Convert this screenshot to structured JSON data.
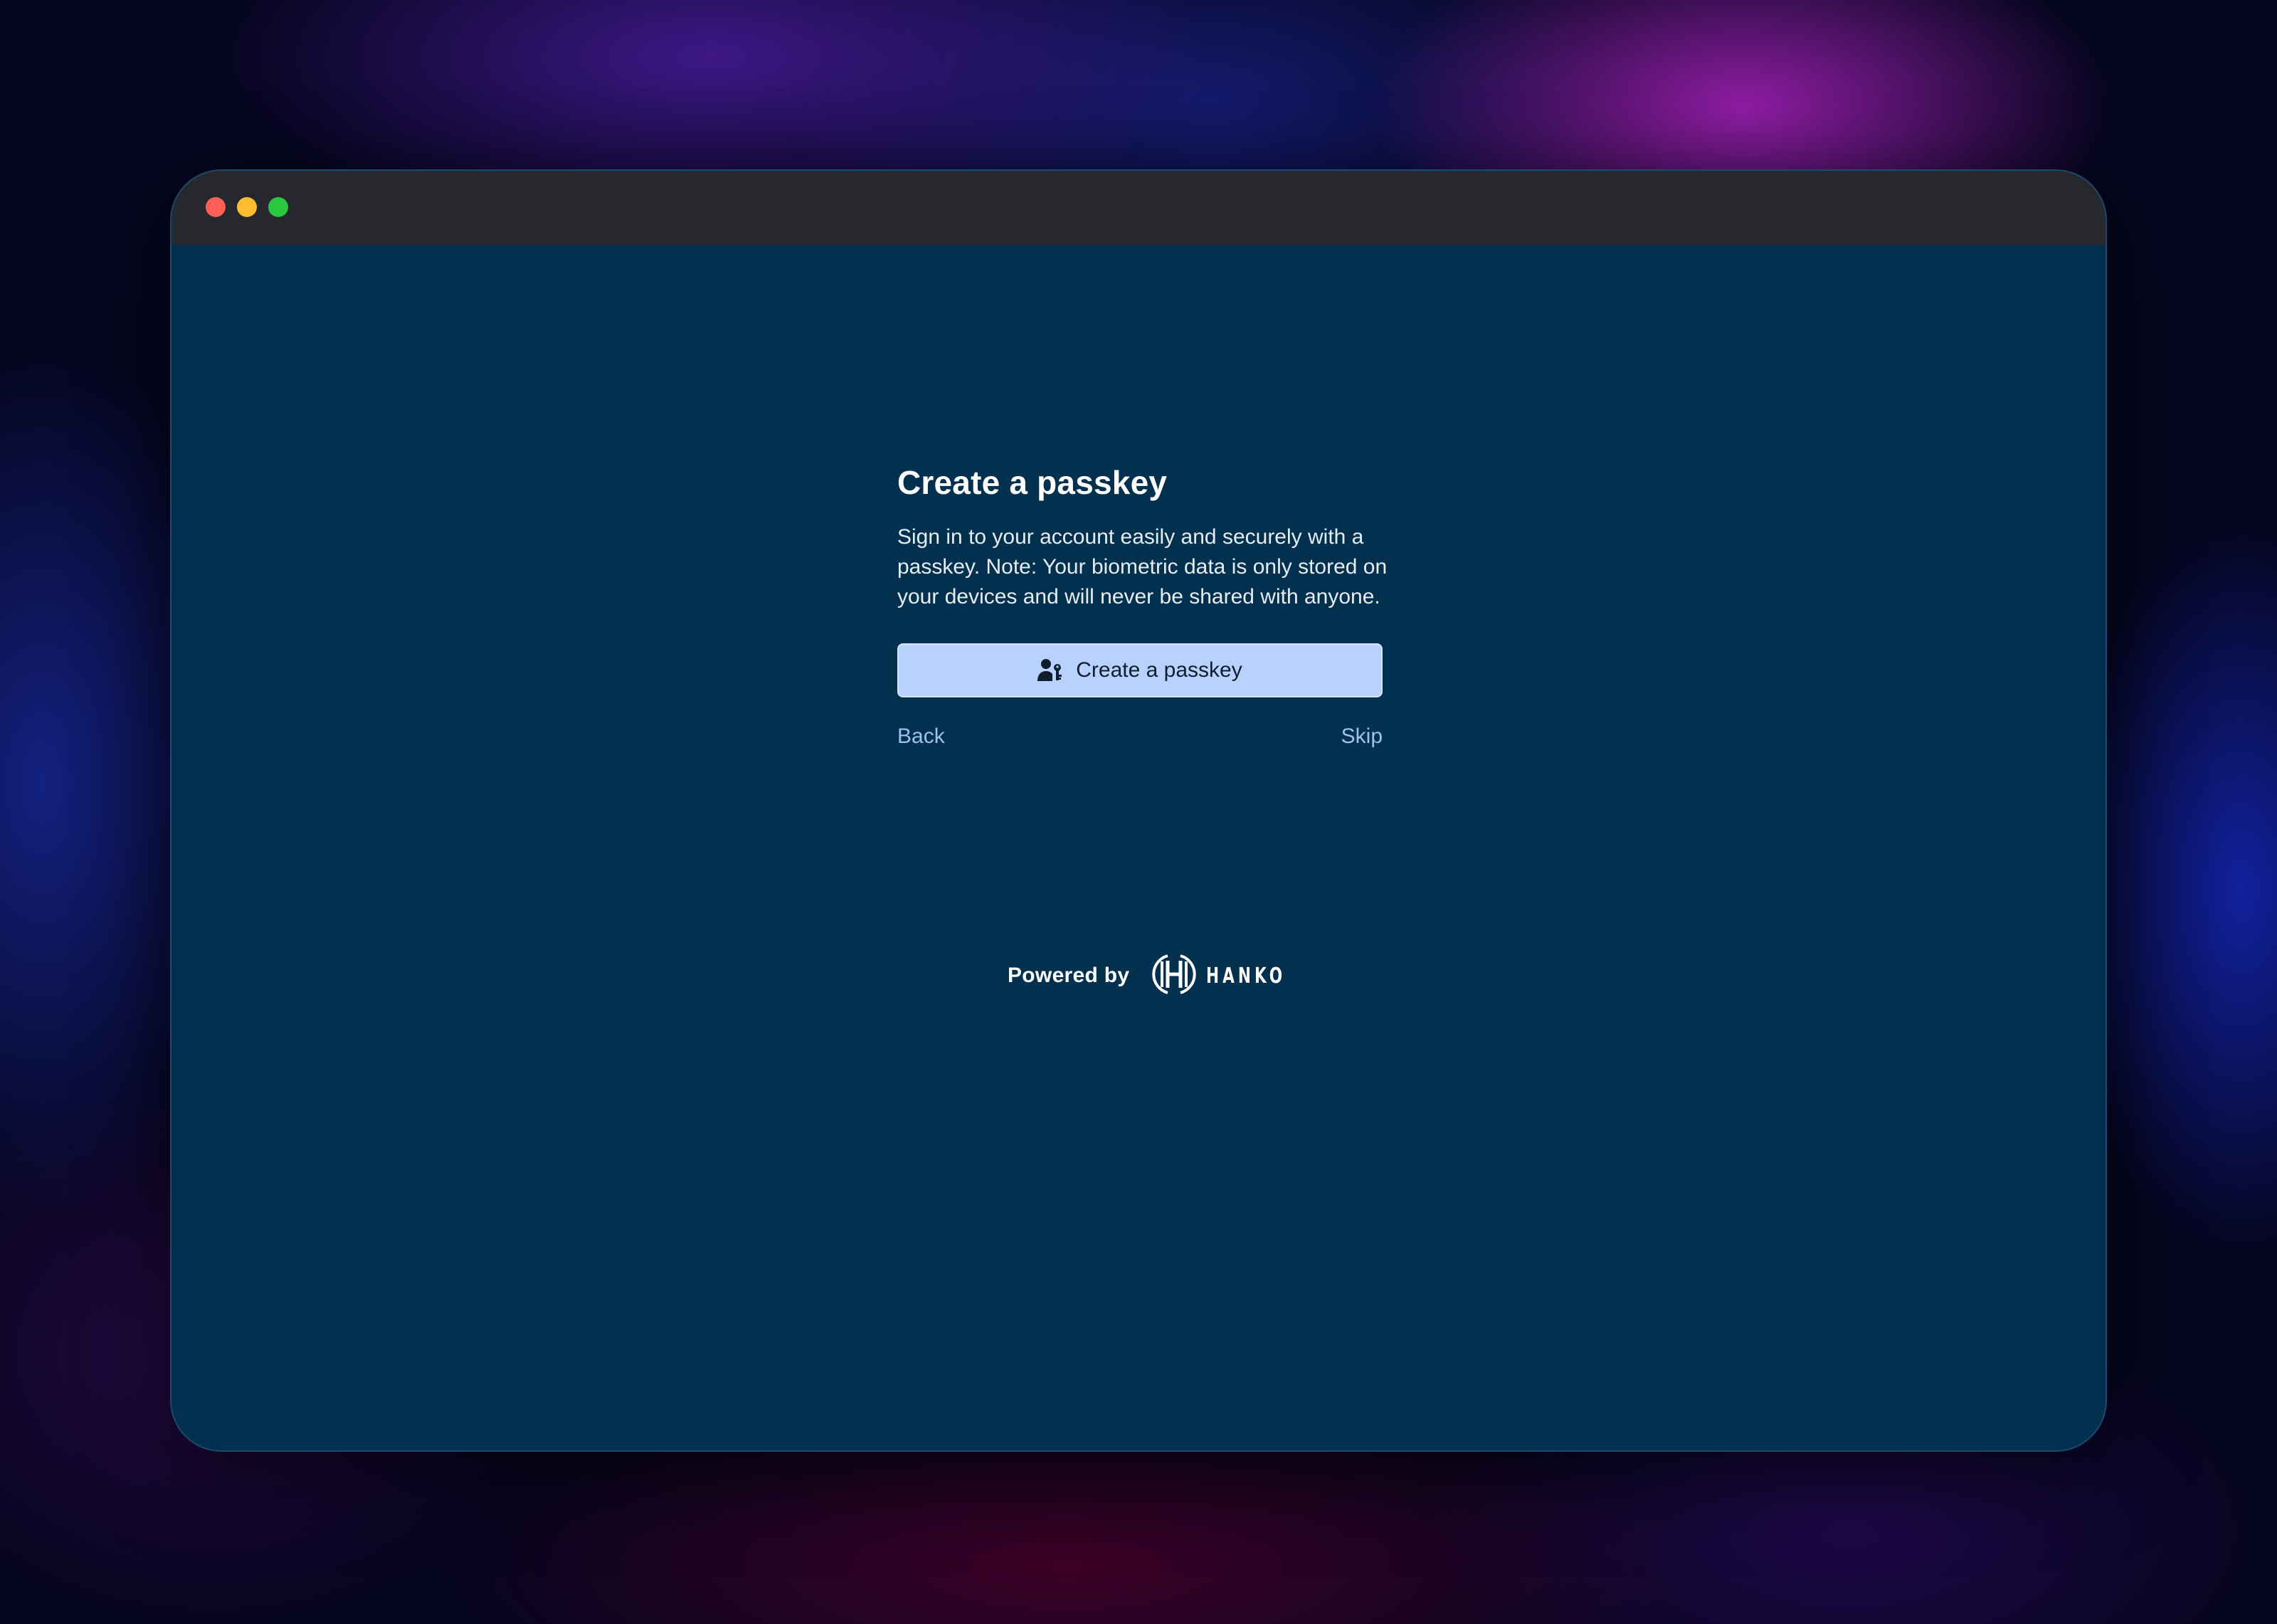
{
  "window": {
    "traffic_lights": [
      {
        "name": "close",
        "color": "#ff5f57"
      },
      {
        "name": "minimize",
        "color": "#febc2e"
      },
      {
        "name": "maximize",
        "color": "#28c840"
      }
    ],
    "background": "#02304f"
  },
  "passkey": {
    "title": "Create a passkey",
    "description": "Sign in to your account easily and securely with a passkey. Note: Your biometric data is only stored on your devices and will never be shared with anyone.",
    "create_button": {
      "label": "Create a passkey",
      "icon": "user-key-icon",
      "color": "#b8d1ff"
    },
    "back_link": "Back",
    "skip_link": "Skip"
  },
  "footer": {
    "powered_by": "Powered by",
    "brand": "HANKO",
    "brand_icon": "hanko-logo-icon"
  }
}
